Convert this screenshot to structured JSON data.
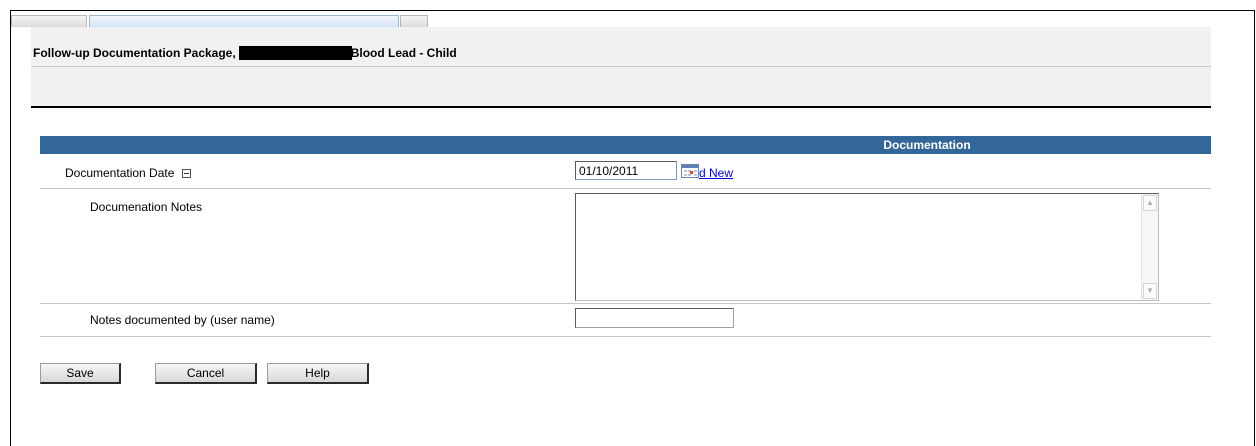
{
  "header": {
    "title_prefix": "Follow-up Documentation Package,",
    "title_suffix": "Blood Lead - Child"
  },
  "section": {
    "title": "Documentation"
  },
  "fields": {
    "documentation_date": {
      "label": "Documentation Date",
      "value": "01/10/2011",
      "add_link": "d New"
    },
    "documentation_notes": {
      "label": "Documenation Notes",
      "value": ""
    },
    "documented_by": {
      "label": "Notes documented by (user name)",
      "value": ""
    }
  },
  "buttons": {
    "save": "Save",
    "cancel": "Cancel",
    "help": "Help"
  },
  "icons": {
    "collapse": "minus-box-icon",
    "calendar": "calendar-icon"
  },
  "colors": {
    "section_bar": "#336699",
    "link": "#0000ee"
  }
}
